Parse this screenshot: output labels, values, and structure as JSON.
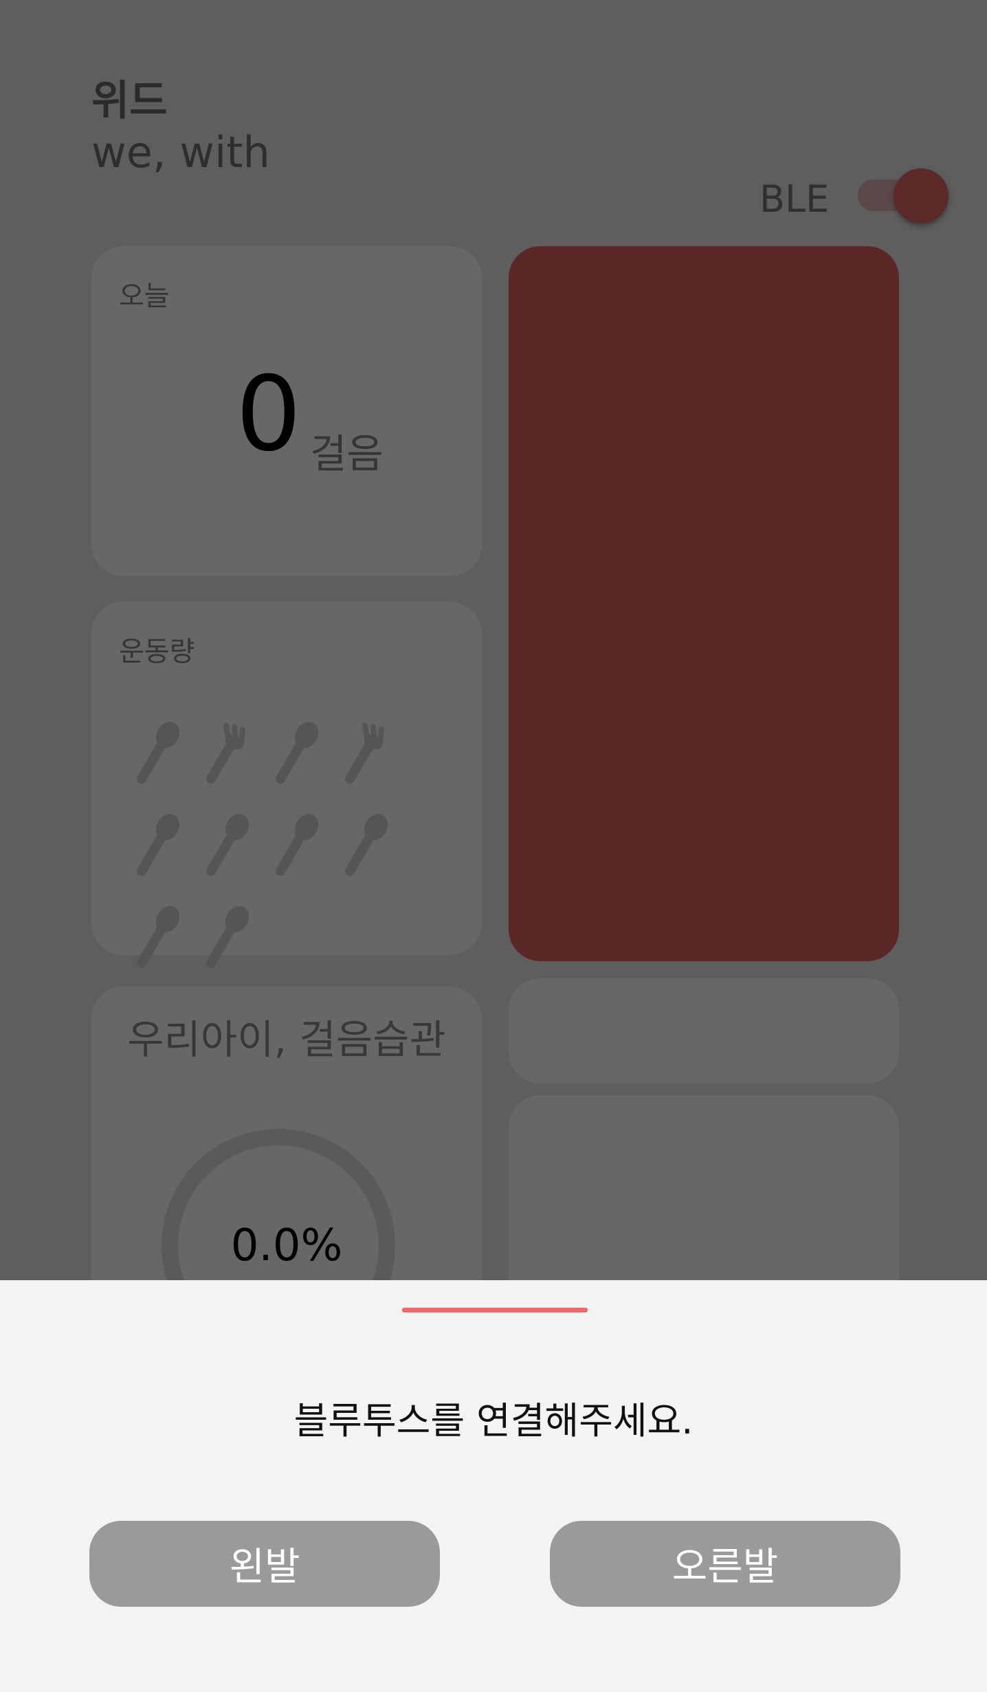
{
  "header": {
    "title": "위드",
    "subtitle": "we, with"
  },
  "ble": {
    "label": "BLE",
    "enabled": true
  },
  "today_card": {
    "label": "오늘",
    "steps": "0",
    "unit": "걸음"
  },
  "exercise_card": {
    "label": "운동량",
    "icons": [
      "spoon-icon",
      "fork-icon",
      "spoon-icon",
      "fork-icon",
      "spoon-icon",
      "spoon-icon",
      "spoon-icon",
      "spoon-icon",
      "spoon-icon",
      "spoon-icon"
    ]
  },
  "habit_card": {
    "title": "우리아이, 걸음습관",
    "percent": "0.0%"
  },
  "colors": {
    "accent": "#ec6a6a",
    "image_card": "#5c2827",
    "toggle": "#5c2828"
  },
  "sheet": {
    "message": "블루투스를 연결해주세요.",
    "left_button": "왼발",
    "right_button": "오른발"
  }
}
